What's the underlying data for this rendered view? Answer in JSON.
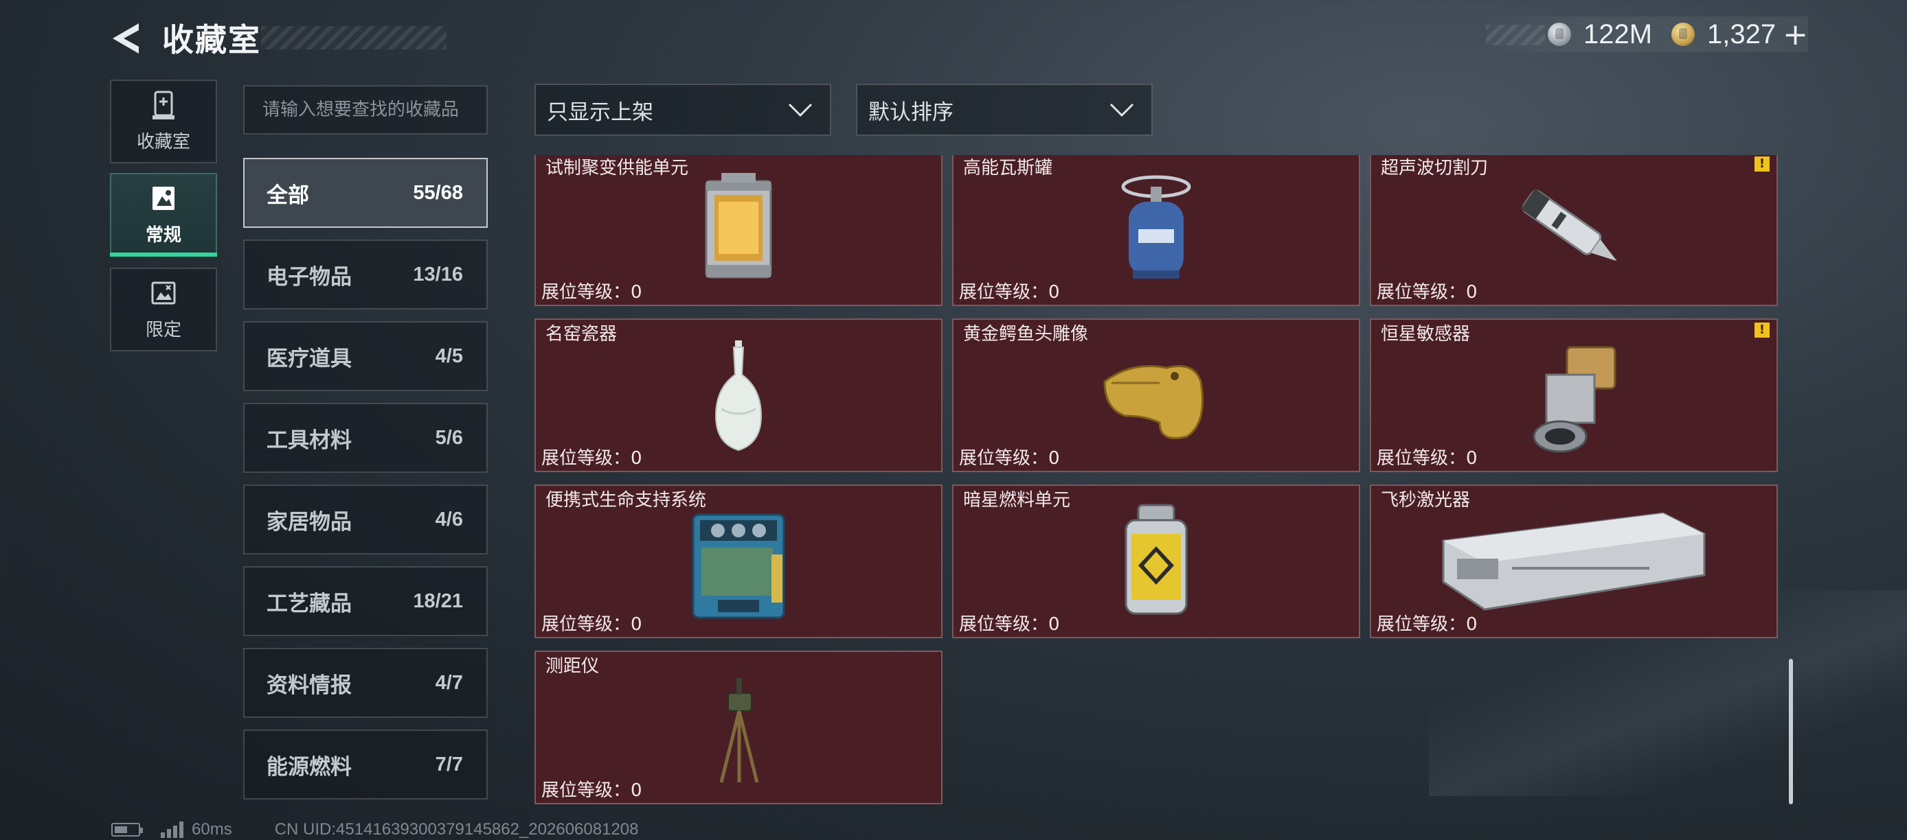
{
  "header": {
    "title": "收藏室",
    "currency_silver": "122M",
    "currency_gold": "1,327",
    "plus_label": "+"
  },
  "side_tabs": [
    {
      "label": "收藏室",
      "icon": "trophy-case-icon",
      "active": false
    },
    {
      "label": "常规",
      "icon": "frame-photo-icon",
      "active": true
    },
    {
      "label": "限定",
      "icon": "limited-photo-icon",
      "active": false
    }
  ],
  "search": {
    "placeholder": "请输入想要查找的收藏品"
  },
  "categories": [
    {
      "name": "全部",
      "count": "55/68",
      "active": true
    },
    {
      "name": "电子物品",
      "count": "13/16"
    },
    {
      "name": "医疗道具",
      "count": "4/5"
    },
    {
      "name": "工具材料",
      "count": "5/6"
    },
    {
      "name": "家居物品",
      "count": "4/6"
    },
    {
      "name": "工艺藏品",
      "count": "18/21"
    },
    {
      "name": "资料情报",
      "count": "4/7"
    },
    {
      "name": "能源燃料",
      "count": "7/7"
    }
  ],
  "filters": {
    "display": "只显示上架",
    "sort": "默认排序"
  },
  "items": [
    {
      "name": "试制聚变供能单元",
      "level": "展位等级：0",
      "icon": "fusion-cell-icon",
      "warning": false
    },
    {
      "name": "高能瓦斯罐",
      "level": "展位等级：0",
      "icon": "gas-canister-icon",
      "warning": false
    },
    {
      "name": "超声波切割刀",
      "level": "展位等级：0",
      "icon": "ultrasonic-cutter-icon",
      "warning": true
    },
    {
      "name": "名窑瓷器",
      "level": "展位等级：0",
      "icon": "porcelain-vase-icon",
      "warning": false
    },
    {
      "name": "黄金鳄鱼头雕像",
      "level": "展位等级：0",
      "icon": "gold-crocodile-statue-icon",
      "warning": false
    },
    {
      "name": "恒星敏感器",
      "level": "展位等级：0",
      "icon": "star-sensor-icon",
      "warning": true
    },
    {
      "name": "便携式生命支持系统",
      "level": "展位等级：0",
      "icon": "life-support-pack-icon",
      "warning": false
    },
    {
      "name": "暗星燃料单元",
      "level": "展位等级：0",
      "icon": "fuel-cell-icon",
      "warning": false
    },
    {
      "name": "飞秒激光器",
      "level": "展位等级：0",
      "icon": "femtosecond-laser-icon",
      "warning": false
    },
    {
      "name": "测距仪",
      "level": "展位等级：0",
      "icon": "rangefinder-tripod-icon",
      "warning": false
    }
  ],
  "footer": {
    "ping": "60ms",
    "uid": "CN UID:4514163930037914586​2_202606081208"
  },
  "colors": {
    "card_bg": "#4a1e25",
    "active_tab_accent": "#34d39a",
    "warning": "#f1c21b"
  }
}
